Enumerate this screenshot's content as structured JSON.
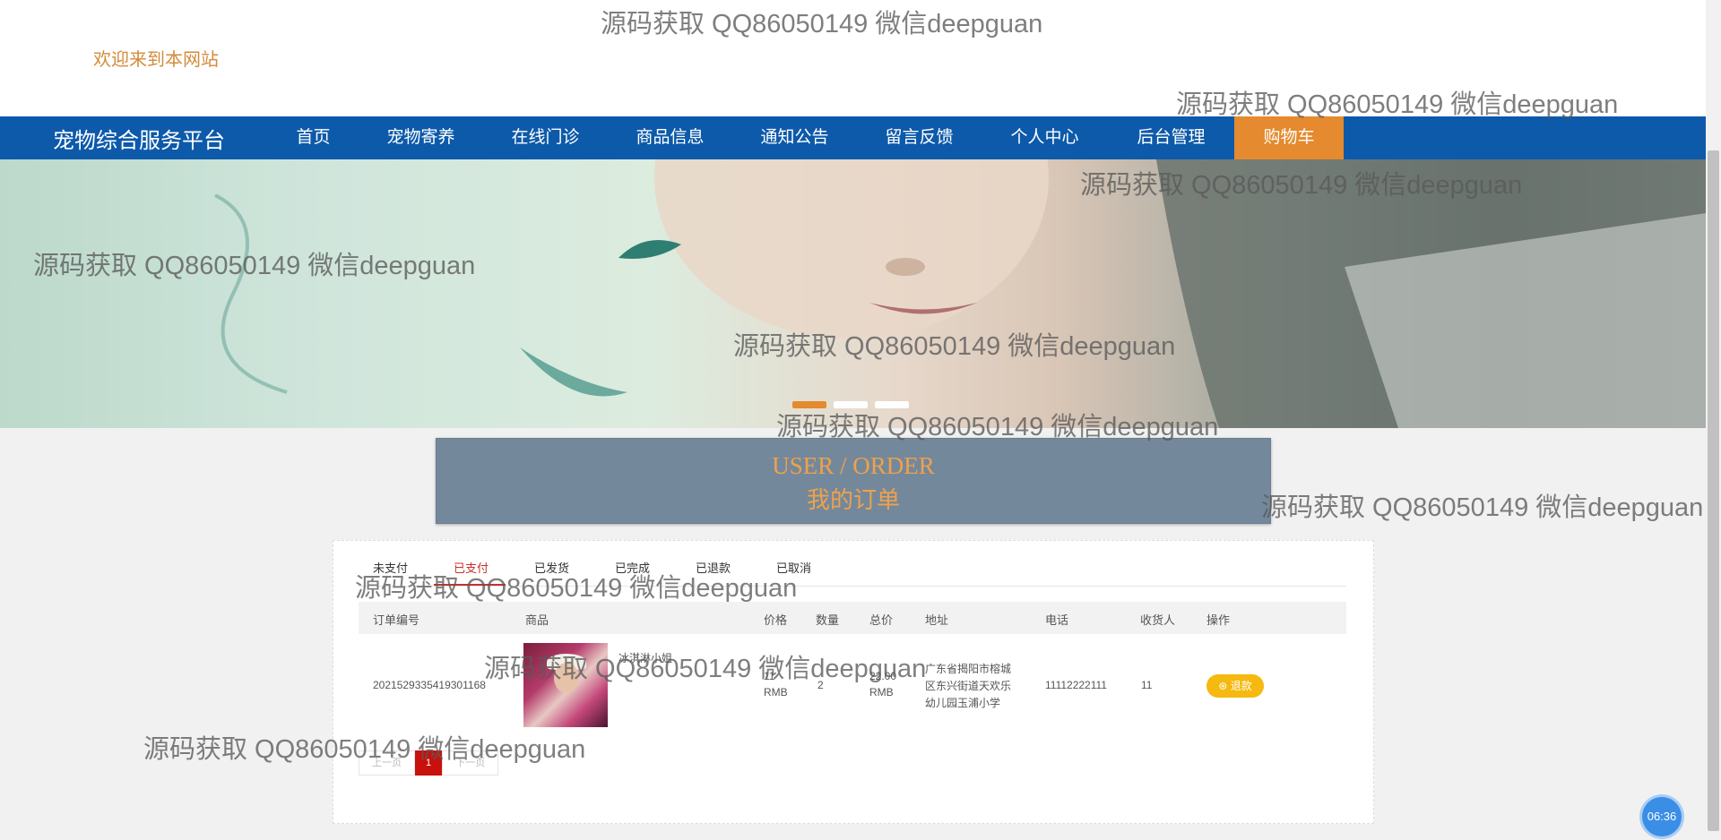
{
  "header": {
    "welcome": "欢迎来到本网站"
  },
  "nav": {
    "brand": "宠物综合服务平台",
    "items": [
      {
        "label": "首页"
      },
      {
        "label": "宠物寄养"
      },
      {
        "label": "在线门诊"
      },
      {
        "label": "商品信息"
      },
      {
        "label": "通知公告"
      },
      {
        "label": "留言反馈"
      },
      {
        "label": "个人中心"
      },
      {
        "label": "后台管理"
      },
      {
        "label": "购物车",
        "active": true
      }
    ]
  },
  "banner": {
    "slides": 3,
    "active_slide": 1
  },
  "order_header": {
    "title_en": "USER / ORDER",
    "title_cn": "我的订单"
  },
  "tabs": [
    {
      "label": "未支付"
    },
    {
      "label": "已支付",
      "active": true
    },
    {
      "label": "已发货"
    },
    {
      "label": "已完成"
    },
    {
      "label": "已退款"
    },
    {
      "label": "已取消"
    }
  ],
  "table": {
    "headers": [
      "订单编号",
      "商品",
      "价格",
      "数量",
      "总价",
      "地址",
      "电话",
      "收货人",
      "操作"
    ],
    "rows": [
      {
        "order_no": "2021529335419301168",
        "goods_name": "冰淇淋小姐",
        "price": "11",
        "price_unit": "RMB",
        "qty": "2",
        "total": "22.00",
        "total_unit": "RMB",
        "address_line1": "广东省揭阳市榕城",
        "address_line2": "区东兴街道天欢乐",
        "address_line3": "幼儿园玉浦小学",
        "phone": "11112222111",
        "receiver": "11",
        "action": "退款"
      }
    ]
  },
  "pagination": {
    "prev": "上一页",
    "current": "1",
    "next": "下一页"
  },
  "clock": {
    "time": "06:36"
  },
  "watermark": {
    "text": "源码获取 QQ86050149 微信deepguan"
  },
  "colors": {
    "nav_bg": "#0d5aaa",
    "nav_active": "#e58a2e",
    "accent_orange": "#f0a14a",
    "refund_btn": "#f5b90f",
    "pager_active": "#c8110c"
  }
}
